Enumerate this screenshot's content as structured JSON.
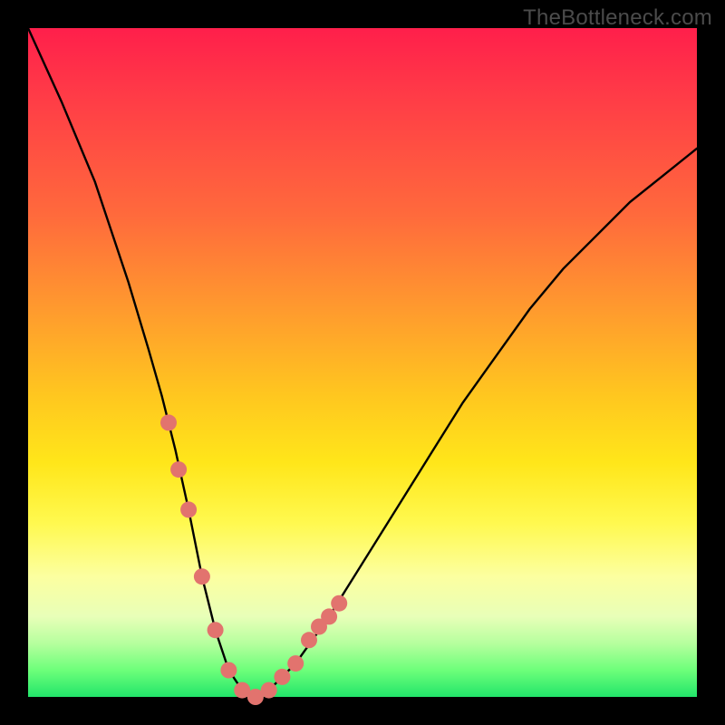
{
  "watermark": "TheBottleneck.com",
  "chart_data": {
    "type": "line",
    "title": "",
    "xlabel": "",
    "ylabel": "",
    "xlim": [
      0,
      100
    ],
    "ylim": [
      0,
      100
    ],
    "series": [
      {
        "name": "bottleneck-curve",
        "x": [
          0,
          5,
          10,
          15,
          18,
          20,
          22,
          24,
          26,
          28,
          30,
          32,
          34,
          36,
          40,
          45,
          50,
          55,
          60,
          65,
          70,
          75,
          80,
          85,
          90,
          95,
          100
        ],
        "values": [
          100,
          89,
          77,
          62,
          52,
          45,
          37,
          28,
          18,
          10,
          4,
          1,
          0,
          1,
          5,
          12,
          20,
          28,
          36,
          44,
          51,
          58,
          64,
          69,
          74,
          78,
          82
        ]
      },
      {
        "name": "marker-dots",
        "x": [
          21.0,
          22.5,
          24.0,
          26.0,
          28.0,
          30.0,
          32.0,
          34.0,
          36.0,
          38.0,
          40.0,
          42.0,
          43.5,
          45.0,
          46.5
        ],
        "values": [
          41.0,
          34.0,
          28.0,
          18.0,
          10.0,
          4.0,
          1.0,
          0.0,
          1.0,
          3.0,
          5.0,
          8.5,
          10.5,
          12.0,
          14.0
        ]
      }
    ],
    "colors": {
      "curve": "#000000",
      "dots": "#e2736e",
      "gradient_top": "#ff1f4b",
      "gradient_bottom": "#22e56a"
    }
  }
}
